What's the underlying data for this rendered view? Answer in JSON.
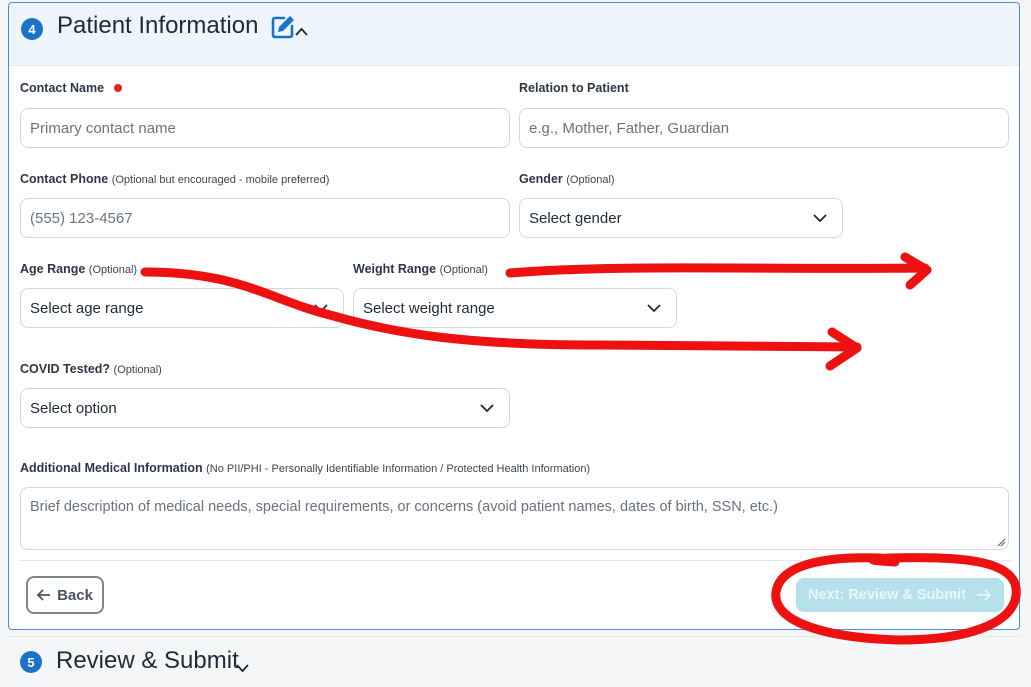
{
  "section4": {
    "step_number": "4",
    "title": "Patient Information"
  },
  "fields": {
    "contact_name": {
      "label": "Contact Name",
      "placeholder": "Primary contact name"
    },
    "relation": {
      "label": "Relation to Patient",
      "placeholder": "e.g., Mother, Father, Guardian"
    },
    "contact_phone": {
      "label": "Contact Phone",
      "hint": "(Optional but encouraged - mobile preferred)",
      "placeholder": "(555) 123-4567"
    },
    "gender": {
      "label": "Gender",
      "hint": "(Optional)",
      "value": "Select gender"
    },
    "age_range": {
      "label": "Age Range",
      "hint": "(Optional)",
      "value": "Select age range"
    },
    "weight_range": {
      "label": "Weight Range",
      "hint": "(Optional)",
      "value": "Select weight range"
    },
    "covid_tested": {
      "label": "COVID Tested?",
      "hint": "(Optional)",
      "value": "Select option"
    },
    "medical_info": {
      "label": "Additional Medical Information",
      "hint": "(No PII/PHI - Personally Identifiable Information / Protected Health Information)",
      "placeholder": "Brief description of medical needs, special requirements, or concerns (avoid patient names, dates of birth, SSN, etc.)"
    }
  },
  "buttons": {
    "back": "Back",
    "next": "Next: Review & Submit"
  },
  "section5": {
    "step_number": "5",
    "title": "Review & Submit"
  },
  "colors": {
    "accent": "#1a73c9",
    "required_dot": "#e8201a",
    "annotation": "#ee1111",
    "next_disabled": "#b6e0ea"
  }
}
